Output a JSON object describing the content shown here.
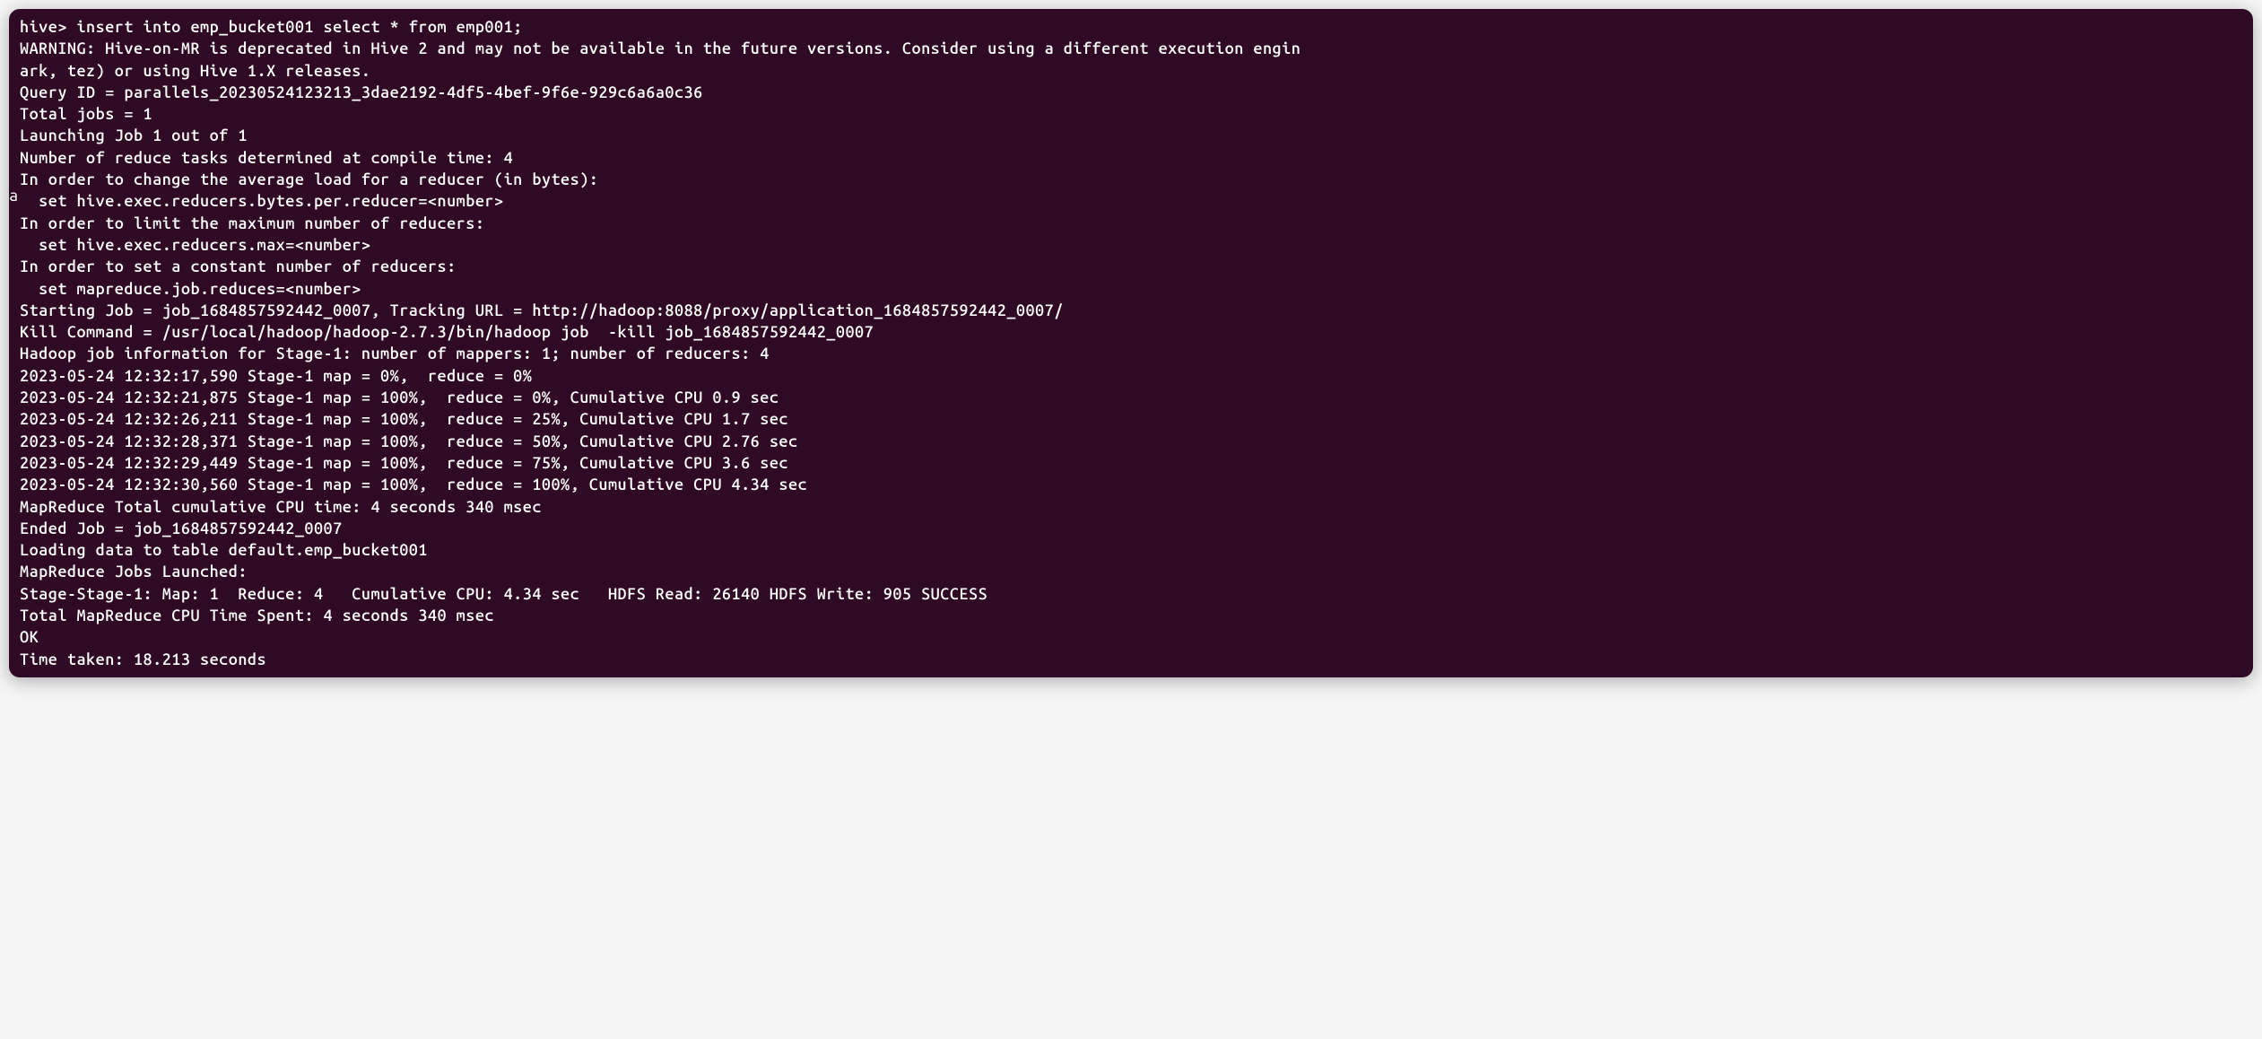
{
  "terminal": {
    "side_char": "a",
    "lines": [
      "hive> insert into emp_bucket001 select * from emp001;",
      "WARNING: Hive-on-MR is deprecated in Hive 2 and may not be available in the future versions. Consider using a different execution engin",
      "ark, tez) or using Hive 1.X releases.",
      "Query ID = parallels_20230524123213_3dae2192-4df5-4bef-9f6e-929c6a6a0c36",
      "Total jobs = 1",
      "Launching Job 1 out of 1",
      "Number of reduce tasks determined at compile time: 4",
      "In order to change the average load for a reducer (in bytes):",
      "  set hive.exec.reducers.bytes.per.reducer=<number>",
      "In order to limit the maximum number of reducers:",
      "  set hive.exec.reducers.max=<number>",
      "In order to set a constant number of reducers:",
      "  set mapreduce.job.reduces=<number>",
      "Starting Job = job_1684857592442_0007, Tracking URL = http://hadoop:8088/proxy/application_1684857592442_0007/",
      "Kill Command = /usr/local/hadoop/hadoop-2.7.3/bin/hadoop job  -kill job_1684857592442_0007",
      "Hadoop job information for Stage-1: number of mappers: 1; number of reducers: 4",
      "2023-05-24 12:32:17,590 Stage-1 map = 0%,  reduce = 0%",
      "2023-05-24 12:32:21,875 Stage-1 map = 100%,  reduce = 0%, Cumulative CPU 0.9 sec",
      "2023-05-24 12:32:26,211 Stage-1 map = 100%,  reduce = 25%, Cumulative CPU 1.7 sec",
      "2023-05-24 12:32:28,371 Stage-1 map = 100%,  reduce = 50%, Cumulative CPU 2.76 sec",
      "2023-05-24 12:32:29,449 Stage-1 map = 100%,  reduce = 75%, Cumulative CPU 3.6 sec",
      "2023-05-24 12:32:30,560 Stage-1 map = 100%,  reduce = 100%, Cumulative CPU 4.34 sec",
      "MapReduce Total cumulative CPU time: 4 seconds 340 msec",
      "Ended Job = job_1684857592442_0007",
      "Loading data to table default.emp_bucket001",
      "MapReduce Jobs Launched:",
      "Stage-Stage-1: Map: 1  Reduce: 4   Cumulative CPU: 4.34 sec   HDFS Read: 26140 HDFS Write: 905 SUCCESS",
      "Total MapReduce CPU Time Spent: 4 seconds 340 msec",
      "OK",
      "Time taken: 18.213 seconds"
    ]
  }
}
